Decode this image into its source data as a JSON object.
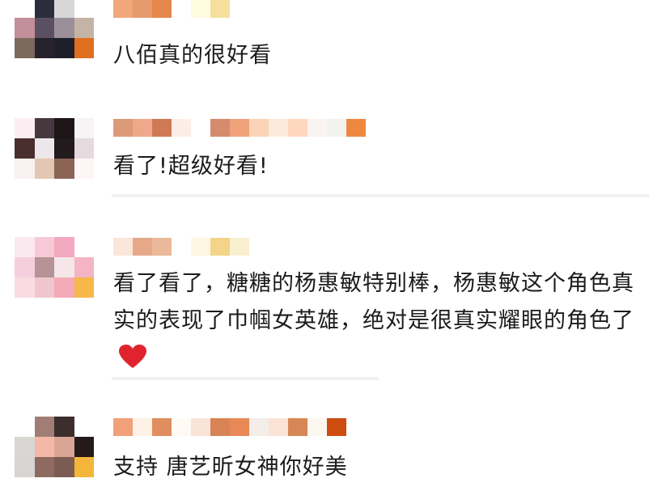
{
  "comments": [
    {
      "text": "八佰真的很好看",
      "avatar_colors": [
        "#ffffff",
        "#2c2d3c",
        "#d9d6d9",
        "#ffffff",
        "#c28f9a",
        "#5a5062",
        "#9b8f9a",
        "#c4b4a6",
        "#7d6a5e",
        "#26232f",
        "#1d1f2a",
        "#e07020"
      ],
      "name_colors": [
        "#f0a878",
        "#e59b6b",
        "#e6874c",
        "#ffffff",
        "#fffbe0",
        "#f4df9d"
      ]
    },
    {
      "text": "看了!超级好看!",
      "avatar_colors": [
        "#fbeef3",
        "#45393f",
        "#1e1517",
        "#f7f4f6",
        "#4a2f2f",
        "#ede7eb",
        "#221a1d",
        "#e5dadf",
        "#f7f2f0",
        "#e2c8b2",
        "#8b6455",
        "#fdf6f4"
      ],
      "name_colors": [
        "#dc9a78",
        "#efa98a",
        "#cf7a55",
        "#fceee4",
        "#ffffff",
        "#d68a6e",
        "#f0a27b",
        "#fbd4b8",
        "#fcebdc",
        "#ffd7bf",
        "#f9f4f1",
        "#f4f2ee",
        "#ee8840"
      ]
    },
    {
      "text": "看了看了，糖糖的杨惠敏特别棒，杨惠敏这个角色真实的表现了巾帼女英雄，绝对是很真实耀眼的角色了",
      "heart_color": "#e0242d",
      "avatar_colors": [
        "#fbe9f0",
        "#f7c9d6",
        "#f3a9c0",
        "#ffffff",
        "#f5d0dc",
        "#b59397",
        "#f5e6ea",
        "#f4b4c4",
        "#f8dce1",
        "#f0c6cc",
        "#f5aab8",
        "#f7b84a"
      ],
      "name_colors": [
        "#fbe6da",
        "#e5a98a",
        "#e9b999",
        "#ffffff",
        "#fdf6e2",
        "#f3d488",
        "#f9f0cf"
      ]
    },
    {
      "text": "支持 唐艺昕女神你好美",
      "avatar_colors": [
        "#ffffff",
        "#a07e75",
        "#3d2e2e",
        "#ffffff",
        "#d9d6d4",
        "#f4b8a6",
        "#d9a696",
        "#241a1c",
        "#d7d4d2",
        "#8f6a60",
        "#7c5b53",
        "#f3b638"
      ],
      "name_colors": [
        "#f1a07a",
        "#fef1e6",
        "#e08d60",
        "#fffaf4",
        "#fae4d8",
        "#d88456",
        "#e88857",
        "#f4ede8",
        "#fbe4d5",
        "#d78755",
        "#fdf7f2",
        "#cd4c10"
      ]
    }
  ]
}
